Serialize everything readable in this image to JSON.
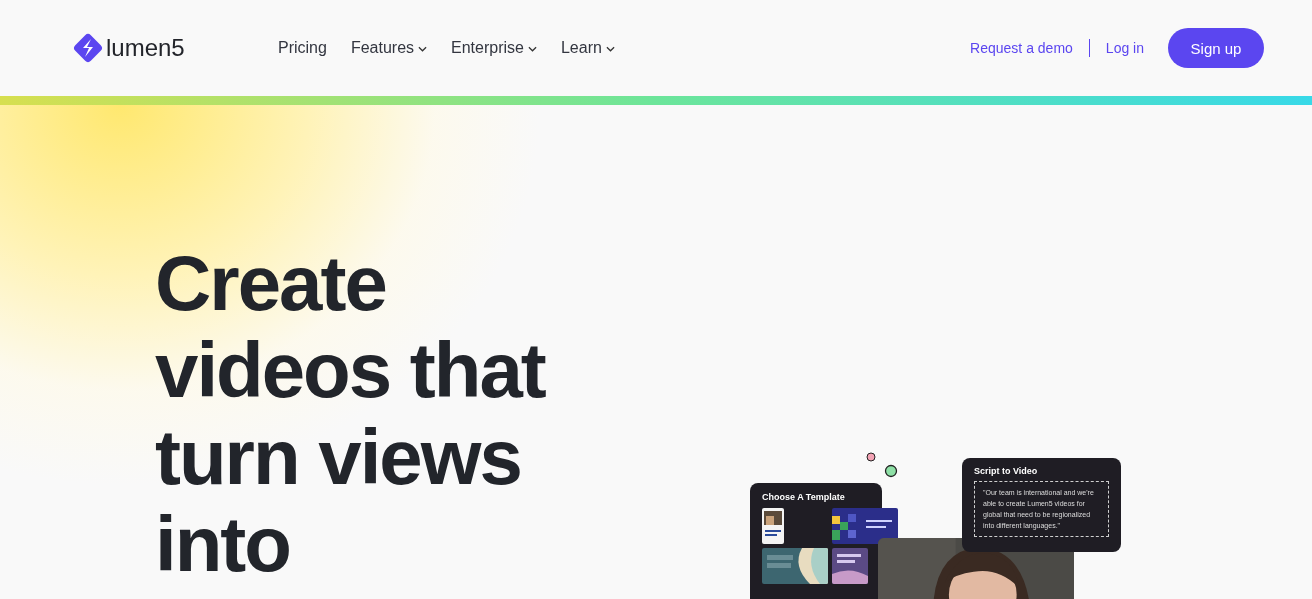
{
  "header": {
    "logo": "lumen5",
    "nav": [
      {
        "label": "Pricing",
        "dropdown": false
      },
      {
        "label": "Features",
        "dropdown": true
      },
      {
        "label": "Enterprise",
        "dropdown": true
      },
      {
        "label": "Learn",
        "dropdown": true
      }
    ],
    "request_demo": "Request a demo",
    "log_in": "Log in",
    "sign_up": "Sign up"
  },
  "hero": {
    "headline": [
      "Create",
      "videos that",
      "turn views",
      "into"
    ],
    "template_card": {
      "title": "Choose A Template"
    },
    "script_card": {
      "title": "Script to Video",
      "quote": "\"Our team is international and we're able to create Lumen5 videos for global that need to be regionalized into different languages.\""
    }
  }
}
